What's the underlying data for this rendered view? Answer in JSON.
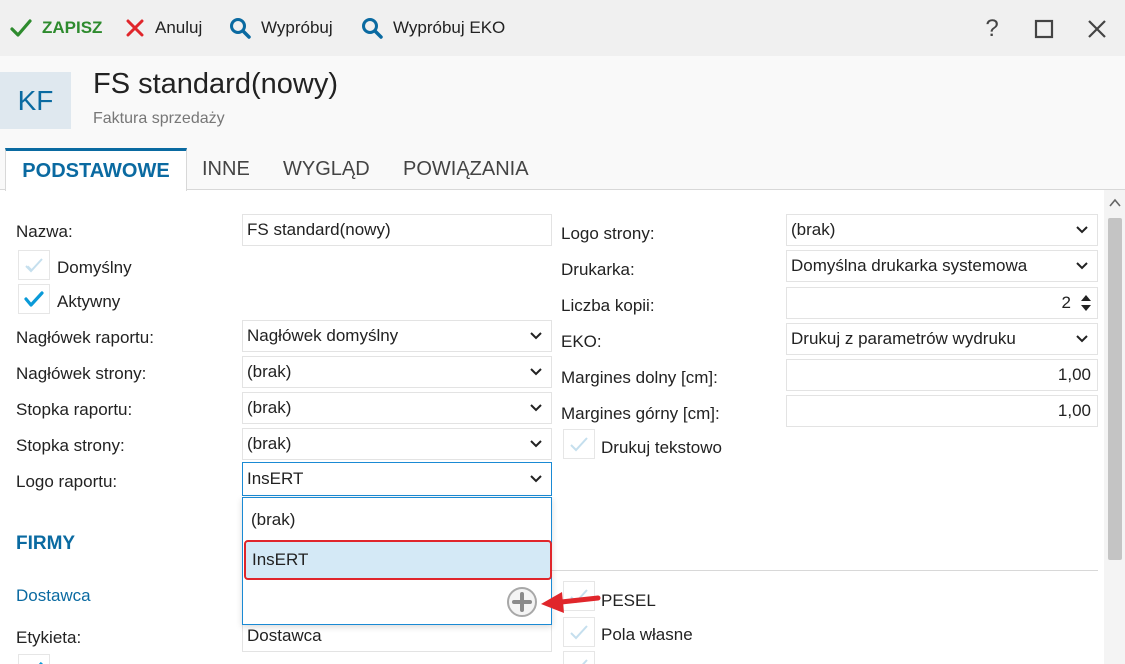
{
  "toolbar": {
    "save": "ZAPISZ",
    "cancel": "Anuluj",
    "try": "Wypróbuj",
    "try_eko": "Wypróbuj EKO",
    "help": "?"
  },
  "header": {
    "badge": "KF",
    "title": "FS standard(nowy)",
    "subtitle": "Faktura sprzedaży"
  },
  "tabs": [
    "PODSTAWOWE",
    "INNE",
    "WYGLĄD",
    "POWIĄZANIA"
  ],
  "left": {
    "nazwa_label": "Nazwa:",
    "nazwa_value": "FS standard(nowy)",
    "domyslny_label": "Domyślny",
    "aktywny_label": "Aktywny",
    "naglowek_raportu_label": "Nagłówek raportu:",
    "naglowek_raportu_value": "Nagłówek domyślny",
    "naglowek_strony_label": "Nagłówek strony:",
    "naglowek_strony_value": "(brak)",
    "stopka_raportu_label": "Stopka raportu:",
    "stopka_raportu_value": "(brak)",
    "stopka_strony_label": "Stopka strony:",
    "stopka_strony_value": "(brak)",
    "logo_raportu_label": "Logo raportu:",
    "logo_raportu_value": "InsERT"
  },
  "right": {
    "logo_strony_label": "Logo strony:",
    "logo_strony_value": "(brak)",
    "drukarka_label": "Drukarka:",
    "drukarka_value": "Domyślna drukarka systemowa",
    "liczba_kopii_label": "Liczba kopii:",
    "liczba_kopii_value": "2",
    "eko_label": "EKO:",
    "eko_value": "Drukuj z parametrów wydruku",
    "margines_dolny_label": "Margines dolny [cm]:",
    "margines_dolny_value": "1,00",
    "margines_gorny_label": "Margines górny [cm]:",
    "margines_gorny_value": "1,00",
    "drukuj_tekstowo_label": "Drukuj tekstowo"
  },
  "dropdown": {
    "options": [
      "(brak)",
      "InsERT"
    ]
  },
  "firmy": {
    "section_title": "FIRMY",
    "dostawca_label": "Dostawca",
    "etykieta_label": "Etykieta:",
    "etykieta_value": "Dostawca",
    "pesel_label": "PESEL",
    "pola_wlasne_label": "Pola własne"
  },
  "colors": {
    "accent": "#0a6aa1",
    "save_green": "#2e8b2e",
    "cancel_red": "#e0262b",
    "focus_border": "#1a8ad4"
  }
}
